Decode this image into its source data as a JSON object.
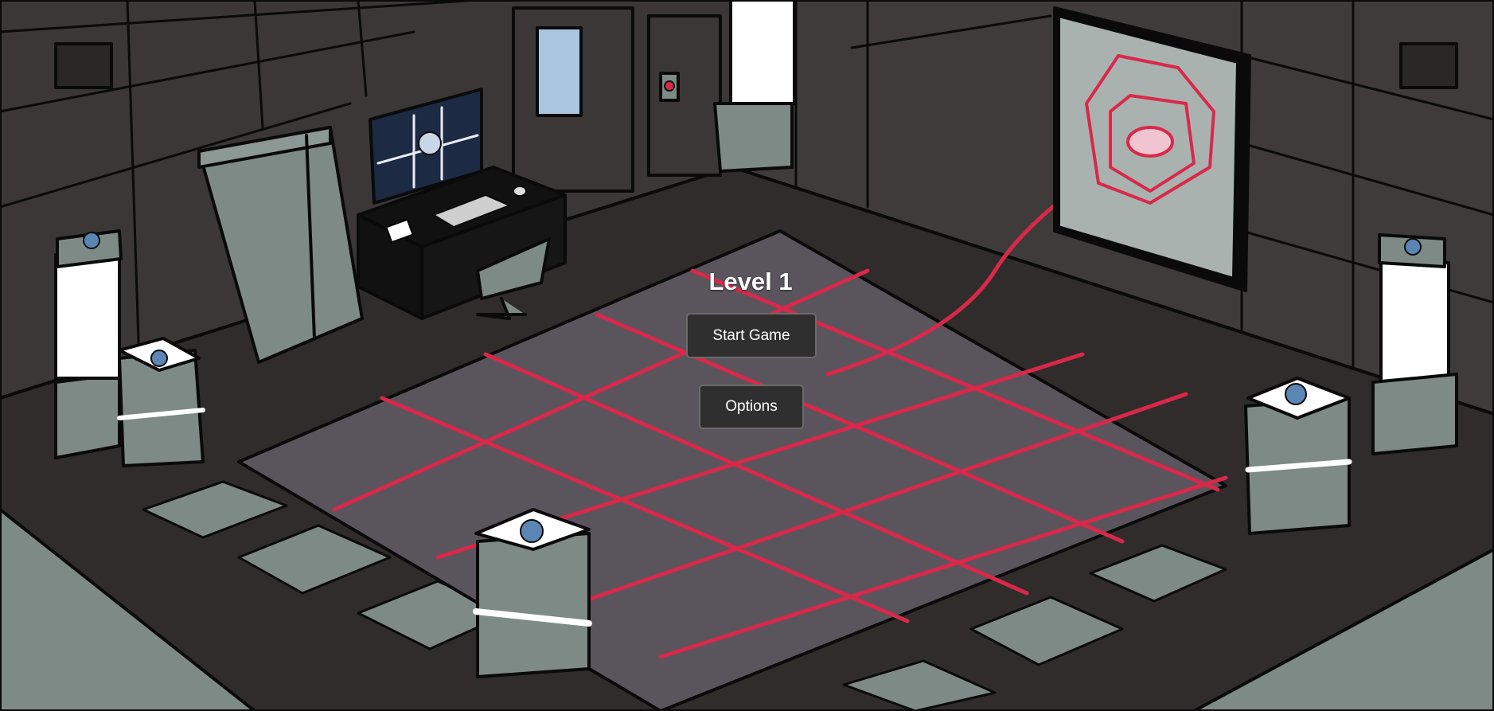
{
  "game": {
    "level_title": "Level 1",
    "start_label": "Start Game",
    "options_label": "Options"
  },
  "colors": {
    "wall": "#3a3736",
    "floor_dark": "#2f2c2b",
    "grid_floor": "#5a555c",
    "laser": "#d9284a",
    "furniture": "#7e8a85",
    "outline": "#0a0a0a",
    "button_bg": "#2f2f2f",
    "button_border": "#6b6b6b"
  },
  "icons": {
    "pedestal_emblem": "spiral-emblem-icon",
    "laser_emitter": "hexagon-laser-emitter-icon",
    "door_button": "red-door-button-icon"
  }
}
